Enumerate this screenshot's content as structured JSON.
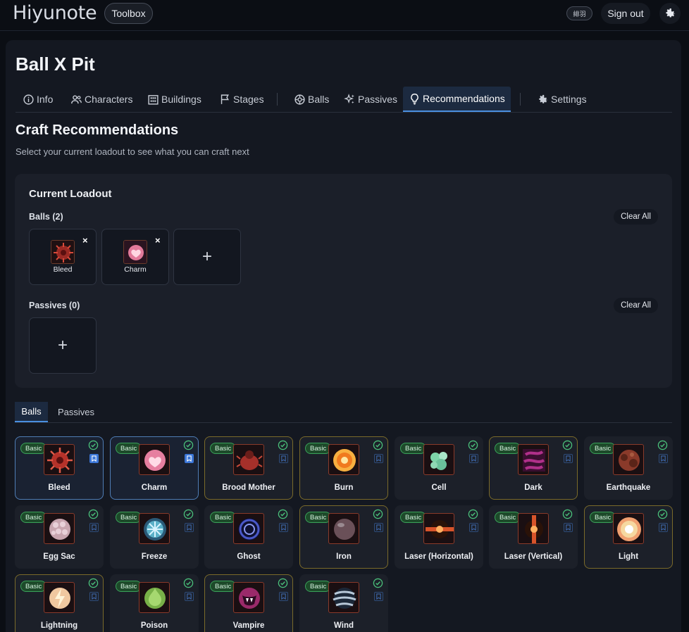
{
  "header": {
    "brand": "Hiyunote",
    "toolbox_label": "Toolbox",
    "language_label": "緋羽",
    "signout_label": "Sign out",
    "settings_icon": "gear-icon"
  },
  "page": {
    "title": "Ball X Pit",
    "tabs": [
      {
        "label": "Info",
        "icon": "info-icon"
      },
      {
        "label": "Characters",
        "icon": "users-icon"
      },
      {
        "label": "Buildings",
        "icon": "building-icon"
      },
      {
        "label": "Stages",
        "icon": "flag-icon"
      },
      {
        "label": "Balls",
        "icon": "ball-icon"
      },
      {
        "label": "Passives",
        "icon": "sparkle-icon"
      },
      {
        "label": "Recommendations",
        "icon": "lightbulb-icon",
        "active": true
      },
      {
        "label": "Settings",
        "icon": "gear-icon"
      }
    ]
  },
  "craft": {
    "title": "Craft Recommendations",
    "subtitle": "Select your current loadout to see what you can craft next"
  },
  "loadout": {
    "title": "Current Loadout",
    "balls_label": "Balls (2)",
    "passives_label": "Passives (0)",
    "clear_label": "Clear All",
    "add_symbol": "+",
    "remove_symbol": "×",
    "balls": [
      {
        "name": "Bleed",
        "color": "#c0392b"
      },
      {
        "name": "Charm",
        "color": "#e8799a"
      }
    ]
  },
  "subtabs": [
    "Balls",
    "Passives"
  ],
  "ball_badge": "Basic",
  "balls": [
    {
      "name": "Bleed",
      "color": "#b5322a",
      "selected": true,
      "gold": false
    },
    {
      "name": "Charm",
      "color": "#e67fa0",
      "selected": true,
      "gold": false
    },
    {
      "name": "Brood Mother",
      "color": "#a5302a",
      "selected": false,
      "gold": true
    },
    {
      "name": "Burn",
      "color": "#f07a1e",
      "selected": false,
      "gold": true
    },
    {
      "name": "Cell",
      "color": "#7ed4a8",
      "selected": false,
      "gold": false
    },
    {
      "name": "Dark",
      "color": "#b0308a",
      "selected": false,
      "gold": true
    },
    {
      "name": "Earthquake",
      "color": "#8a3a2a",
      "selected": false,
      "gold": false
    },
    {
      "name": "Egg Sac",
      "color": "#c9a6b0",
      "selected": false,
      "gold": false
    },
    {
      "name": "Freeze",
      "color": "#5ab0c8",
      "selected": false,
      "gold": false
    },
    {
      "name": "Ghost",
      "color": "#4a58c8",
      "selected": false,
      "gold": false
    },
    {
      "name": "Iron",
      "color": "#6a5058",
      "selected": false,
      "gold": true
    },
    {
      "name": "Laser (Horizontal)",
      "color": "#d8542a",
      "selected": false,
      "gold": false
    },
    {
      "name": "Laser (Vertical)",
      "color": "#d8542a",
      "selected": false,
      "gold": false
    },
    {
      "name": "Light",
      "color": "#f6d8a0",
      "selected": false,
      "gold": true
    },
    {
      "name": "Lightning",
      "color": "#f0c8a0",
      "selected": false,
      "gold": true
    },
    {
      "name": "Poison",
      "color": "#78b048",
      "selected": false,
      "gold": false
    },
    {
      "name": "Vampire",
      "color": "#9a2a6a",
      "selected": false,
      "gold": true
    },
    {
      "name": "Wind",
      "color": "#b8c8d8",
      "selected": false,
      "gold": false
    }
  ]
}
